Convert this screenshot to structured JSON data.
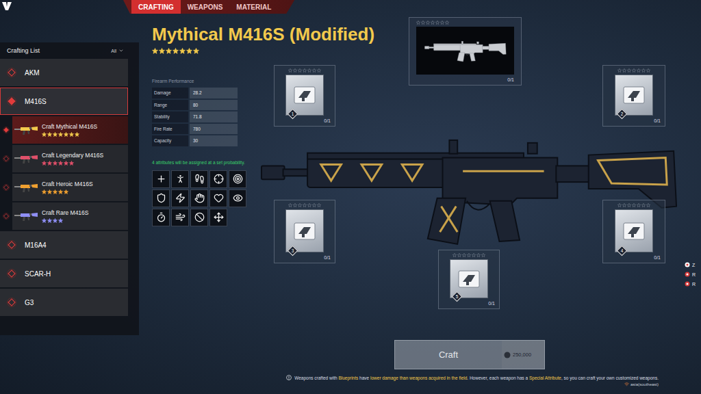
{
  "top_nav": {
    "tabs": [
      {
        "label": "CRAFTING",
        "selected": true
      },
      {
        "label": "WEAPONS",
        "selected": false
      },
      {
        "label": "MATERIAL",
        "selected": false
      }
    ]
  },
  "sidebar": {
    "title": "Crafting List",
    "filter": "All",
    "items": [
      {
        "label": "AKM",
        "kind": "category",
        "selected": false
      },
      {
        "label": "M416S",
        "kind": "category",
        "selected": true
      },
      {
        "label": "Craft Mythical M416S",
        "kind": "recipe",
        "selected": true,
        "stars": 7,
        "color": "#f2c94c"
      },
      {
        "label": "Craft Legendary M416S",
        "kind": "recipe",
        "selected": false,
        "stars": 6,
        "color": "#e0506a"
      },
      {
        "label": "Craft Heroic M416S",
        "kind": "recipe",
        "selected": false,
        "stars": 5,
        "color": "#f0a030"
      },
      {
        "label": "Craft Rare M416S",
        "kind": "recipe",
        "selected": false,
        "stars": 4,
        "color": "#8f8ff5"
      },
      {
        "label": "M16A4",
        "kind": "category",
        "selected": false
      },
      {
        "label": "SCAR-H",
        "kind": "category",
        "selected": false
      },
      {
        "label": "G3",
        "kind": "category",
        "selected": false
      }
    ]
  },
  "max_stars": 7,
  "weapon": {
    "title": "Mythical M416S (Modified)",
    "stars": 7
  },
  "performance": {
    "heading": "Firearm Performance",
    "stats": [
      {
        "label": "Damage",
        "value": "28.2"
      },
      {
        "label": "Range",
        "value": "80"
      },
      {
        "label": "Stability",
        "value": "71.8"
      },
      {
        "label": "Fire Rate",
        "value": "780"
      },
      {
        "label": "Capacity",
        "value": "30"
      }
    ]
  },
  "attributes": {
    "note": "4 attributes will be assigned at a set probability.",
    "icons": [
      {
        "kind": "heal"
      },
      {
        "kind": "stand"
      },
      {
        "kind": "run"
      },
      {
        "kind": "aim"
      },
      {
        "kind": "target"
      },
      {
        "kind": "armor"
      },
      {
        "kind": "speed"
      },
      {
        "kind": "grab"
      },
      {
        "kind": "health"
      },
      {
        "kind": "scope"
      },
      {
        "kind": "reload"
      },
      {
        "kind": "recoil"
      },
      {
        "kind": "cancel"
      },
      {
        "kind": "move"
      }
    ]
  },
  "blueprint": {
    "count": "0/1",
    "stars": 0
  },
  "materials": [
    {
      "number": "1",
      "count": "0/1",
      "stars": 0
    },
    {
      "number": "2",
      "count": "0/1",
      "stars": 0
    },
    {
      "number": "3",
      "count": "0/1",
      "stars": 0
    },
    {
      "number": "4",
      "count": "0/1",
      "stars": 0
    },
    {
      "number": "5",
      "count": "0/1",
      "stars": 0
    }
  ],
  "craft_button": {
    "label": "Craft",
    "cost": "250,000",
    "disabled": true
  },
  "side_list": [
    {
      "label": "Z"
    },
    {
      "label": "R"
    },
    {
      "label": "R"
    }
  ],
  "notice": {
    "segments": [
      {
        "text": "Weapons crafted with ",
        "highlight": false
      },
      {
        "text": "Blueprints",
        "highlight": true
      },
      {
        "text": " have ",
        "highlight": false
      },
      {
        "text": "lower damage than weapons acquired in the field",
        "highlight": true
      },
      {
        "text": ". However, each weapon has a ",
        "highlight": false
      },
      {
        "text": "Special Attribute",
        "highlight": true
      },
      {
        "text": ", so you can craft your own customized weapons.",
        "highlight": false
      }
    ]
  },
  "region": "asia(southeast)"
}
